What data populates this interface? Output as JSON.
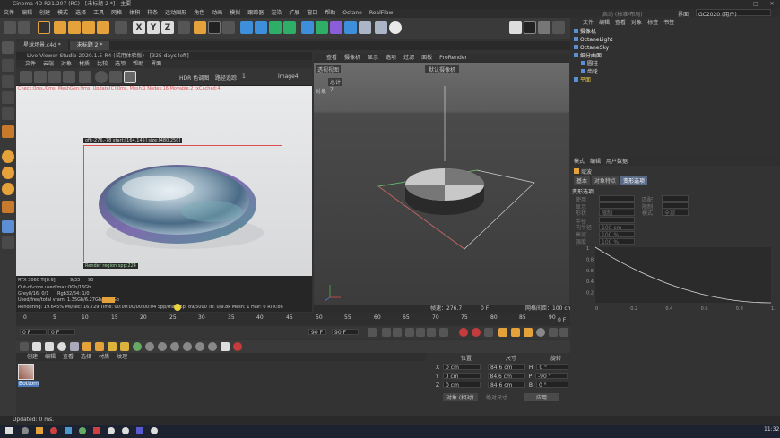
{
  "window": {
    "title": "Cinema 4D R21.207 (RC) - [未标题 2 *] - 主要"
  },
  "menubar": [
    "文件",
    "编辑",
    "创建",
    "模式",
    "选择",
    "工具",
    "网格",
    "体积",
    "样条",
    "运动图形",
    "角色",
    "动画",
    "模拟",
    "跟踪器",
    "渲染",
    "扩展",
    "窗口",
    "帮助",
    "Octane",
    "RealFlow"
  ],
  "layout": {
    "label": "界面",
    "value": "GC2020 (用户)",
    "mode": "启动 (标准/布局)"
  },
  "doctabs": [
    "星球场景.c4d *",
    "未标题 2 *"
  ],
  "liveviewer": {
    "title": "Live Viewer Studio 2020.1.5-R4 (试用体验版) - [325 days left]",
    "menu": [
      "文件",
      "云端",
      "对象",
      "材质",
      "比较",
      "选项",
      "帮助",
      "界面"
    ],
    "hdr_label": "HDR 色调图",
    "mode_label": "路径追踪",
    "samples": "1",
    "image_select": "Image4",
    "status_line": "Check:0ms./0ms. MeshGen:9ms. Update[C]:0ms. Mesh:1 Nodes:16 Movable:2 txCached:4",
    "region_label": "off:-276,-78 start:[164,145] size:[480,250]",
    "render_region": "Render region spp:224",
    "info": {
      "gpu": "RTX 3060 Ti[8.6]",
      "gpu_pct": "9/33",
      "gpu_val": "90",
      "outofcore": "Out-of-core used/max:0Gb/16Gb",
      "grey": "Grey8/16: 0/1",
      "rgb": "Rgb32/64: 1/0",
      "vram": "Used/free/total vram: 1.35Gb/6.27Gb/7.75Gb",
      "rendering": "Rendering: 19.645%  Ms/sec: 16.729  Time: 00:00:00/00:00:04  Spp/maxspp: 89/5000  Tri: 0/9.8k  Mesh: 1  Hair: 0  RTX:on"
    }
  },
  "viewport": {
    "menu": [
      "查看",
      "摄像机",
      "显示",
      "选项",
      "过滤",
      "面板",
      "ProRender"
    ],
    "camera_label": "透视视图",
    "camera_select": "默认摄像机",
    "row_label": "对象",
    "row_count": "7",
    "row_tag": "总计",
    "speed": "帧速：276.7",
    "grid": "网格间距：100 cm",
    "frame": "0 F"
  },
  "timeline": {
    "ticks": [
      "0",
      "5",
      "10",
      "15",
      "20",
      "25",
      "30",
      "35",
      "40",
      "45",
      "50",
      "55",
      "60",
      "65",
      "70",
      "75",
      "80",
      "85",
      "90"
    ],
    "start": "0 F",
    "current": "0 F",
    "end": "90 F",
    "end2": "90 F",
    "current_right": "0 F"
  },
  "materials": {
    "menu": [
      "创建",
      "编辑",
      "查看",
      "选择",
      "材质",
      "纹理"
    ],
    "items": [
      {
        "label": "Bottom"
      }
    ]
  },
  "coords": {
    "headers": [
      "位置",
      "尺寸",
      "旋转"
    ],
    "rows": [
      {
        "axis": "X",
        "pos": "0 cm",
        "size": "84.6 cm",
        "rot_axis": "H",
        "rot": "0 °"
      },
      {
        "axis": "Y",
        "pos": "0 cm",
        "size": "84.6 cm",
        "rot_axis": "P",
        "rot": "-90 °"
      },
      {
        "axis": "Z",
        "pos": "0 cm",
        "size": "84.6 cm",
        "rot_axis": "B",
        "rot": "0 °"
      }
    ],
    "mode": "对象 (相对)",
    "size_mode": "绝对尺寸",
    "apply": "应用"
  },
  "objects": {
    "menu": [
      "文件",
      "编辑",
      "查看",
      "对象",
      "标签",
      "书签"
    ],
    "items": [
      {
        "name": "摄像机",
        "indent": 0,
        "color": "#e8e8e8"
      },
      {
        "name": "OctaneLight",
        "indent": 0,
        "color": "#e8e8e8"
      },
      {
        "name": "OctaneSky",
        "indent": 0,
        "color": "#e8e8e8"
      },
      {
        "name": "细分曲面",
        "indent": 0,
        "color": "#e8e8e8"
      },
      {
        "name": "圆柱",
        "indent": 1,
        "color": "#e8e8e8"
      },
      {
        "name": "齿轮",
        "indent": 1,
        "color": "#e8e8e8"
      },
      {
        "name": "平面",
        "indent": 0,
        "color": "#e8c84a"
      }
    ]
  },
  "attributes": {
    "menu": [
      "模式",
      "编辑",
      "用户数据"
    ],
    "object_label": "域波",
    "tabs": [
      "基本",
      "对象特点",
      "变形选项"
    ],
    "section": "变形选项",
    "rows": [
      {
        "label": "使用",
        "val": "",
        "label2": "匹配",
        "val2": ""
      },
      {
        "label": "显示",
        "val": "",
        "label2": "限制",
        "val2": ""
      },
      {
        "label": "形状",
        "val": "限制",
        "label2": "模式",
        "val2": "全部"
      },
      {
        "label": "半径",
        "val": "",
        "label2": "",
        "val2": ""
      },
      {
        "label": "内半径",
        "val": "100 cm",
        "label2": "",
        "val2": ""
      },
      {
        "label": "衰减",
        "val": "100 %",
        "label2": "",
        "val2": ""
      },
      {
        "label": "强度",
        "val": "100 %",
        "label2": "",
        "val2": ""
      }
    ],
    "graph_y_ticks": [
      "1",
      "0.8",
      "0.6",
      "0.4",
      "0.2"
    ],
    "graph_x_ticks": [
      "0",
      "0.2",
      "0.4",
      "0.6",
      "0.8",
      "1.0"
    ]
  },
  "status": {
    "text": "Updated: 0 ms."
  },
  "taskbar": {
    "time": "11:32"
  }
}
